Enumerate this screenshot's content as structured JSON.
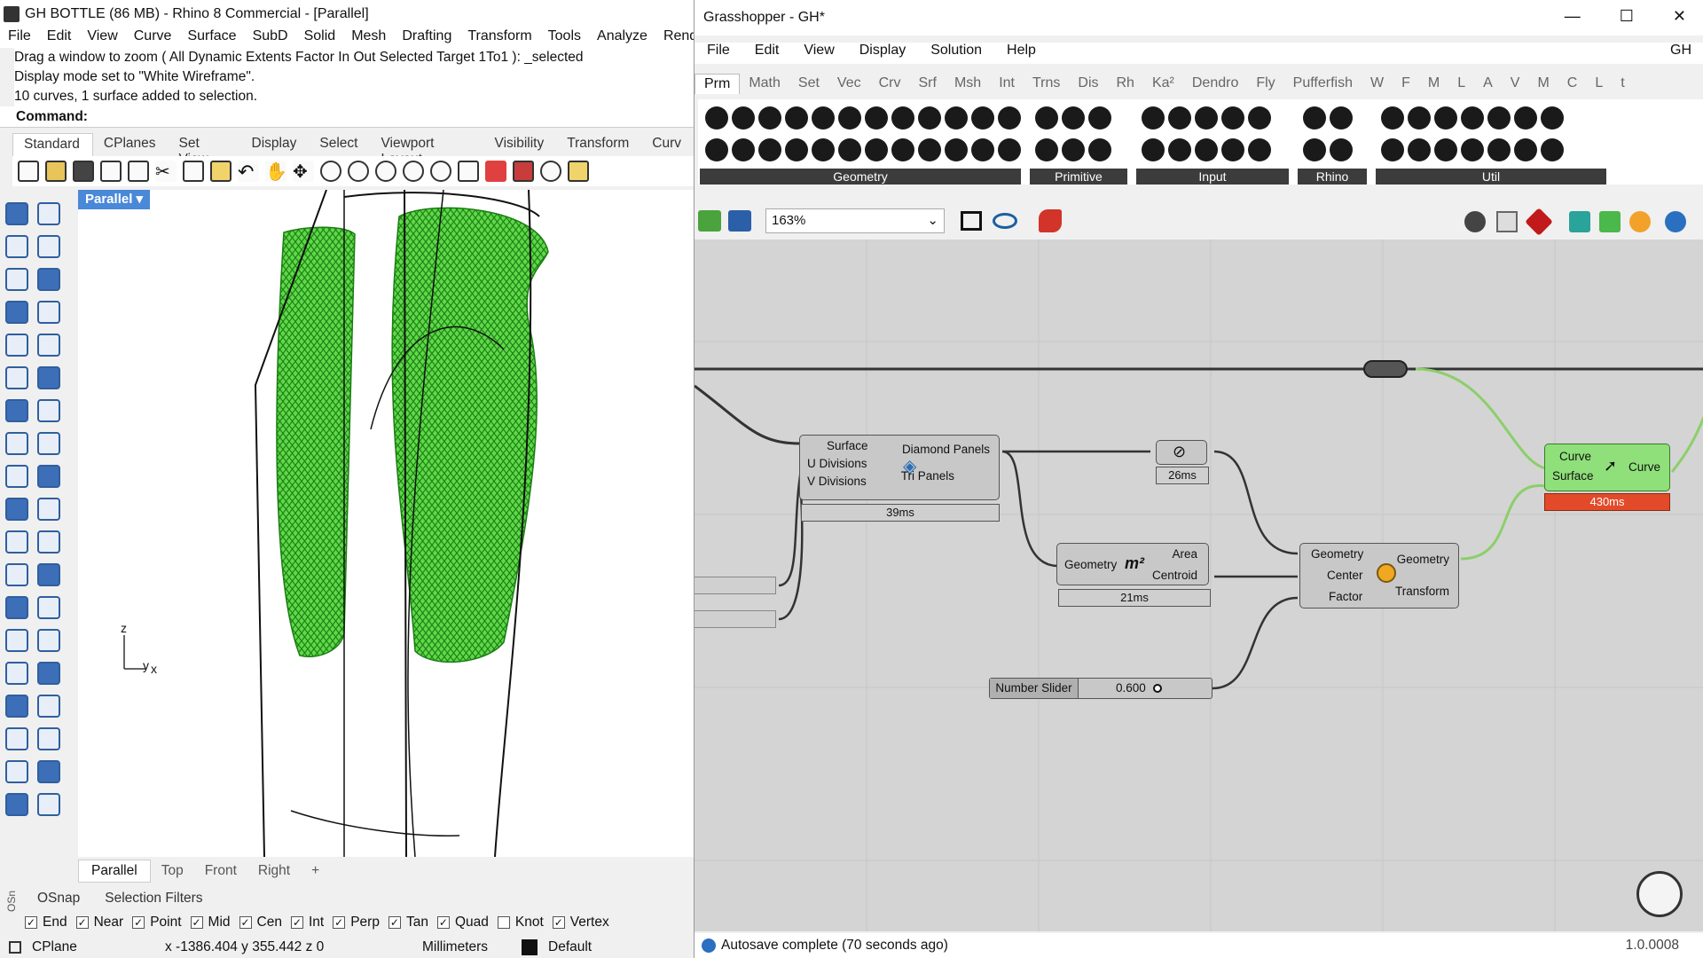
{
  "rhino": {
    "title": "GH BOTTLE (86 MB) - Rhino 8 Commercial - [Parallel]",
    "menu": [
      "File",
      "Edit",
      "View",
      "Curve",
      "Surface",
      "SubD",
      "Solid",
      "Mesh",
      "Drafting",
      "Transform",
      "Tools",
      "Analyze",
      "Render"
    ],
    "history": [
      "Drag a window to zoom ( All  Dynamic  Extents  Factor  In  Out  Selected  Target  1To1 ): _selected",
      "Display mode set to \"White Wireframe\".",
      "10 curves, 1 surface added to selection."
    ],
    "command_prompt": "Command:",
    "toolbar_tabs": [
      "Standard",
      "CPlanes",
      "Set View",
      "Display",
      "Select",
      "Viewport Layout",
      "Visibility",
      "Transform",
      "Curv"
    ],
    "viewport_label": "Parallel",
    "axis_labels": {
      "z": "z",
      "y": "y",
      "x": "x"
    },
    "viewport_tabs": [
      "Parallel",
      "Top",
      "Front",
      "Right",
      "+"
    ],
    "osnap_tabs": [
      "OSnap",
      "Selection Filters"
    ],
    "osnap_side_label": "OSn",
    "osnaps": [
      {
        "label": "End",
        "checked": true
      },
      {
        "label": "Near",
        "checked": true
      },
      {
        "label": "Point",
        "checked": true
      },
      {
        "label": "Mid",
        "checked": true
      },
      {
        "label": "Cen",
        "checked": true
      },
      {
        "label": "Int",
        "checked": true
      },
      {
        "label": "Perp",
        "checked": true
      },
      {
        "label": "Tan",
        "checked": true
      },
      {
        "label": "Quad",
        "checked": true
      },
      {
        "label": "Knot",
        "checked": false
      },
      {
        "label": "Vertex",
        "checked": true
      }
    ],
    "status": {
      "cplane": "CPlane",
      "coords": "x -1386.404  y 355.442  z 0",
      "units": "Millimeters",
      "layer": "Default"
    }
  },
  "gh": {
    "title": "Grasshopper - GH*",
    "window_controls": [
      "—",
      "☐",
      "✕"
    ],
    "menu": [
      "File",
      "Edit",
      "View",
      "Display",
      "Solution",
      "Help"
    ],
    "menu_right": "GH",
    "tabs": [
      "Prm",
      "Math",
      "Set",
      "Vec",
      "Crv",
      "Srf",
      "Msh",
      "Int",
      "Trns",
      "Dis",
      "Rh",
      "Ka²",
      "Dendro",
      "Fly",
      "Pufferfish",
      "W",
      "F",
      "M",
      "L",
      "A",
      "V",
      "M",
      "C",
      "L",
      "t"
    ],
    "ribbon_groups": [
      "Geometry",
      "Primitive",
      "Input",
      "Rhino",
      "Util"
    ],
    "zoom": "163%",
    "components": {
      "diamond": {
        "inputs": [
          "Surface",
          "U Divisions",
          "V Divisions"
        ],
        "outputs": [
          "Diamond Panels",
          "Tri Panels"
        ],
        "time": "39ms"
      },
      "small": {
        "time": "26ms"
      },
      "area": {
        "inputs": [
          "Geometry"
        ],
        "outputs": [
          "Area",
          "Centroid"
        ],
        "icon": "m²",
        "time": "21ms"
      },
      "scale": {
        "inputs": [
          "Geometry",
          "Center",
          "Factor"
        ],
        "outputs": [
          "Geometry",
          "Transform"
        ]
      },
      "curve_on_srf": {
        "inputs": [
          "Curve",
          "Surface"
        ],
        "outputs": [
          "Curve"
        ],
        "time": "430ms"
      },
      "slider": {
        "label": "Number Slider",
        "value": "0.600"
      }
    },
    "status": "Autosave complete (70 seconds ago)",
    "version": "1.0.0008"
  },
  "colors": {
    "gh_canvas": "#d4d4d4",
    "mesh_green": "#2fae1f",
    "component_gray": "#c8c8c8",
    "component_green": "#8fe07a",
    "time_red": "#e24a2a",
    "viewport_label": "#4a88d8"
  }
}
